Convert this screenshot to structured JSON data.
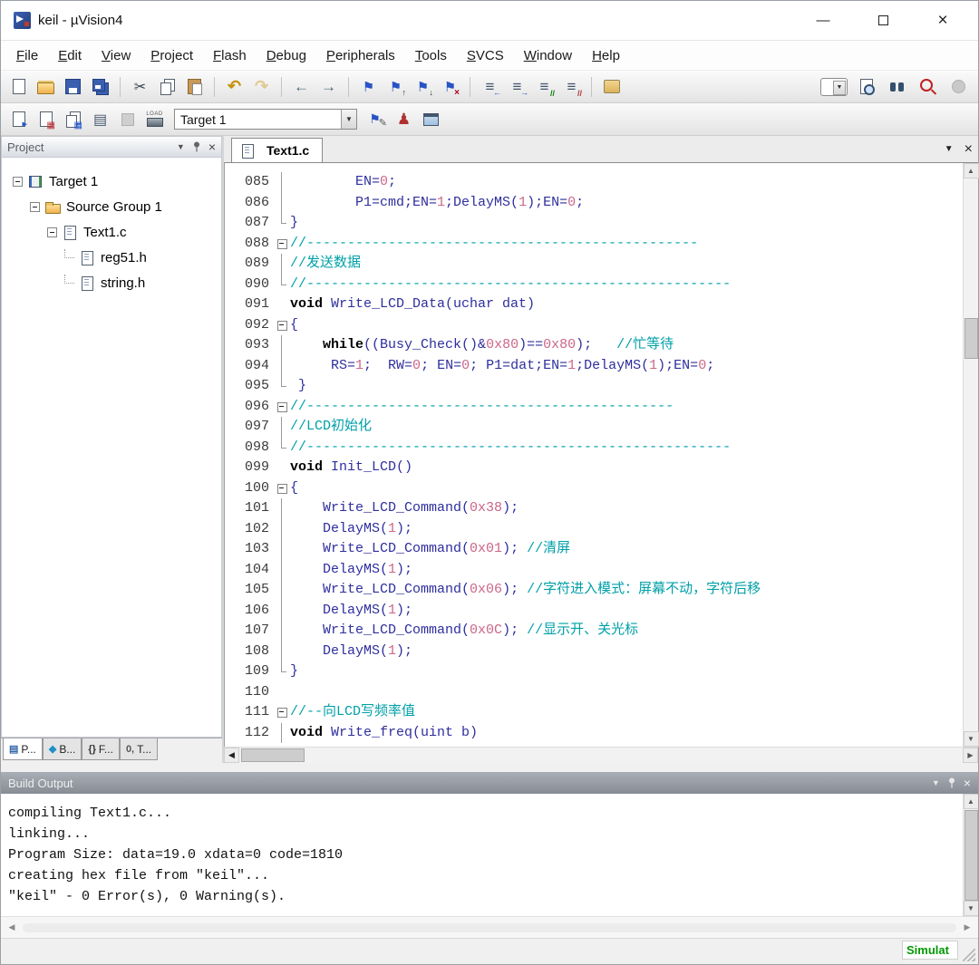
{
  "window": {
    "title": "keil - µVision4"
  },
  "menu": {
    "items": [
      "File",
      "Edit",
      "View",
      "Project",
      "Flash",
      "Debug",
      "Peripherals",
      "Tools",
      "SVCS",
      "Window",
      "Help"
    ]
  },
  "toolbar1": {
    "groups": [
      [
        "new-file",
        "open-folder",
        "save",
        "save-all"
      ],
      [
        "cut",
        "copy",
        "paste"
      ],
      [
        "undo",
        "redo"
      ],
      [
        "nav-back",
        "nav-forward"
      ],
      [
        "bookmark",
        "bookmark-prev",
        "bookmark-next",
        "bookmark-clear"
      ],
      [
        "outdent",
        "indent",
        "comment",
        "uncomment"
      ],
      [
        "configure"
      ]
    ],
    "right": [
      "find-combo",
      "find-in-files",
      "binoculars",
      "find-red",
      "disabled-dot"
    ]
  },
  "toolbar2": {
    "left": [
      "translate",
      "build",
      "rebuild",
      "batch-build",
      "stop-build",
      "load"
    ],
    "target_select": "Target 1",
    "right": [
      "target-options",
      "manage",
      "window-split"
    ]
  },
  "project_panel": {
    "title": "Project",
    "tree": [
      {
        "label": "Target 1",
        "level": 0,
        "icon": "target",
        "expand": true
      },
      {
        "label": "Source Group 1",
        "level": 1,
        "icon": "folder",
        "expand": true
      },
      {
        "label": "Text1.c",
        "level": 2,
        "icon": "file",
        "expand": true
      },
      {
        "label": "reg51.h",
        "level": 3,
        "icon": "file",
        "expand": false
      },
      {
        "label": "string.h",
        "level": 3,
        "icon": "file",
        "expand": false
      }
    ],
    "tabs": [
      {
        "icon": "▤",
        "label": "P...",
        "active": true
      },
      {
        "icon": "◆",
        "label": "B...",
        "active": false
      },
      {
        "icon": "{}",
        "label": "F...",
        "active": false
      },
      {
        "icon": "0,",
        "label": "T...",
        "active": false
      }
    ]
  },
  "editor": {
    "tab": "Text1.c",
    "lines": [
      {
        "n": "085",
        "f": "l",
        "s": [
          [
            "d",
            "        EN="
          ],
          [
            "n",
            "0"
          ],
          [
            "d",
            ";"
          ]
        ]
      },
      {
        "n": "086",
        "f": "l",
        "s": [
          [
            "d",
            "        P1=cmd;EN="
          ],
          [
            "n",
            "1"
          ],
          [
            "d",
            ";DelayMS("
          ],
          [
            "n",
            "1"
          ],
          [
            "d",
            ");EN="
          ],
          [
            "n",
            "0"
          ],
          [
            "d",
            ";"
          ]
        ]
      },
      {
        "n": "087",
        "f": "e",
        "s": [
          [
            "d",
            "}"
          ]
        ]
      },
      {
        "n": "088",
        "f": "b",
        "s": [
          [
            "c",
            "//------------------------------------------------"
          ]
        ]
      },
      {
        "n": "089",
        "f": "l",
        "s": [
          [
            "c",
            "//发送数据"
          ]
        ]
      },
      {
        "n": "090",
        "f": "e",
        "s": [
          [
            "c",
            "//----------------------------------------------------"
          ]
        ]
      },
      {
        "n": "091",
        "f": "",
        "s": [
          [
            "k",
            "void"
          ],
          [
            "d",
            " Write_LCD_Data(uchar dat)"
          ]
        ]
      },
      {
        "n": "092",
        "f": "b",
        "s": [
          [
            "d",
            "{"
          ]
        ]
      },
      {
        "n": "093",
        "f": "l",
        "s": [
          [
            "d",
            "    "
          ],
          [
            "k",
            "while"
          ],
          [
            "d",
            "((Busy_Check()&"
          ],
          [
            "n",
            "0x80"
          ],
          [
            "d",
            ")=="
          ],
          [
            "n",
            "0x80"
          ],
          [
            "d",
            ");   "
          ],
          [
            "c",
            "//忙等待"
          ]
        ]
      },
      {
        "n": "094",
        "f": "l",
        "s": [
          [
            "d",
            "     RS="
          ],
          [
            "n",
            "1"
          ],
          [
            "d",
            ";  RW="
          ],
          [
            "n",
            "0"
          ],
          [
            "d",
            "; EN="
          ],
          [
            "n",
            "0"
          ],
          [
            "d",
            "; P1=dat;EN="
          ],
          [
            "n",
            "1"
          ],
          [
            "d",
            ";DelayMS("
          ],
          [
            "n",
            "1"
          ],
          [
            "d",
            ");EN="
          ],
          [
            "n",
            "0"
          ],
          [
            "d",
            ";"
          ]
        ]
      },
      {
        "n": "095",
        "f": "e",
        "s": [
          [
            "d",
            " }"
          ]
        ]
      },
      {
        "n": "096",
        "f": "b",
        "s": [
          [
            "c",
            "//---------------------------------------------"
          ]
        ]
      },
      {
        "n": "097",
        "f": "l",
        "s": [
          [
            "c",
            "//LCD初始化"
          ]
        ]
      },
      {
        "n": "098",
        "f": "e",
        "s": [
          [
            "c",
            "//----------------------------------------------------"
          ]
        ]
      },
      {
        "n": "099",
        "f": "",
        "s": [
          [
            "k",
            "void"
          ],
          [
            "d",
            " Init_LCD()"
          ]
        ]
      },
      {
        "n": "100",
        "f": "b",
        "s": [
          [
            "d",
            "{"
          ]
        ]
      },
      {
        "n": "101",
        "f": "l",
        "s": [
          [
            "d",
            "    Write_LCD_Command("
          ],
          [
            "n",
            "0x38"
          ],
          [
            "d",
            ");"
          ]
        ]
      },
      {
        "n": "102",
        "f": "l",
        "s": [
          [
            "d",
            "    DelayMS("
          ],
          [
            "n",
            "1"
          ],
          [
            "d",
            ");"
          ]
        ]
      },
      {
        "n": "103",
        "f": "l",
        "s": [
          [
            "d",
            "    Write_LCD_Command("
          ],
          [
            "n",
            "0x01"
          ],
          [
            "d",
            "); "
          ],
          [
            "c",
            "//清屏"
          ]
        ]
      },
      {
        "n": "104",
        "f": "l",
        "s": [
          [
            "d",
            "    DelayMS("
          ],
          [
            "n",
            "1"
          ],
          [
            "d",
            ");"
          ]
        ]
      },
      {
        "n": "105",
        "f": "l",
        "s": [
          [
            "d",
            "    Write_LCD_Command("
          ],
          [
            "n",
            "0x06"
          ],
          [
            "d",
            "); "
          ],
          [
            "c",
            "//字符进入模式：屏幕不动，字符后移"
          ]
        ]
      },
      {
        "n": "106",
        "f": "l",
        "s": [
          [
            "d",
            "    DelayMS("
          ],
          [
            "n",
            "1"
          ],
          [
            "d",
            ");"
          ]
        ]
      },
      {
        "n": "107",
        "f": "l",
        "s": [
          [
            "d",
            "    Write_LCD_Command("
          ],
          [
            "n",
            "0x0C"
          ],
          [
            "d",
            "); "
          ],
          [
            "c",
            "//显示开、关光标"
          ]
        ]
      },
      {
        "n": "108",
        "f": "l",
        "s": [
          [
            "d",
            "    DelayMS("
          ],
          [
            "n",
            "1"
          ],
          [
            "d",
            ");"
          ]
        ]
      },
      {
        "n": "109",
        "f": "e",
        "s": [
          [
            "d",
            "}"
          ]
        ]
      },
      {
        "n": "110",
        "f": "",
        "s": []
      },
      {
        "n": "111",
        "f": "b",
        "s": [
          [
            "c",
            "//--向LCD写频率值"
          ]
        ]
      },
      {
        "n": "112",
        "f": "l",
        "s": [
          [
            "k",
            "void"
          ],
          [
            "d",
            " Write_freq(uint b)"
          ]
        ]
      }
    ]
  },
  "build_output": {
    "title": "Build Output",
    "lines": [
      "compiling Text1.c...",
      "linking...",
      "Program Size: data=19.0 xdata=0 code=1810",
      "creating hex file from \"keil\"...",
      "\"keil\" - 0 Error(s), 0 Warning(s)."
    ]
  },
  "status_bar": {
    "mode": "Simulat"
  }
}
